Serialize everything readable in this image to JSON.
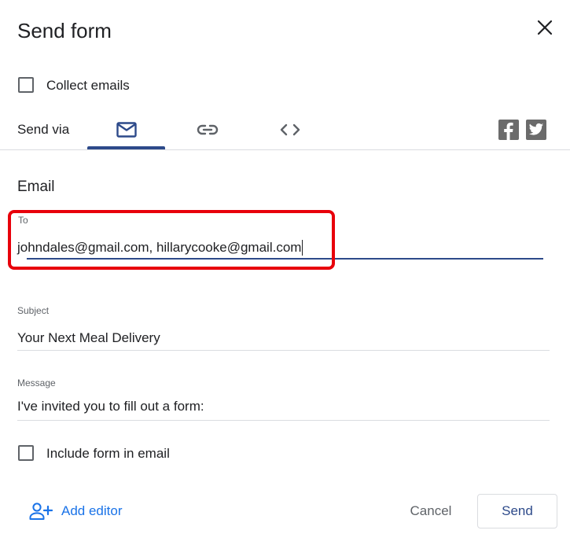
{
  "dialog": {
    "title": "Send form",
    "close_icon": "close-icon"
  },
  "collect_emails": {
    "label": "Collect emails",
    "checked": false
  },
  "send_via": {
    "label": "Send via",
    "tabs": [
      {
        "icon": "mail-icon",
        "active": true
      },
      {
        "icon": "link-icon",
        "active": false
      },
      {
        "icon": "code-embed-icon",
        "active": false
      }
    ],
    "social": [
      {
        "icon": "facebook-icon"
      },
      {
        "icon": "twitter-icon"
      }
    ],
    "accent_color": "#2d4a8a"
  },
  "email": {
    "section_title": "Email",
    "to": {
      "label": "To",
      "value": "johndales@gmail.com, hillarycooke@gmail.com"
    },
    "subject": {
      "label": "Subject",
      "value": "Your Next Meal Delivery"
    },
    "message": {
      "label": "Message",
      "value": "I've invited you to fill out a form:"
    }
  },
  "include_form": {
    "label": "Include form in email",
    "checked": false
  },
  "footer": {
    "add_editor_label": "Add editor",
    "add_editor_icon": "person-add-icon",
    "cancel_label": "Cancel",
    "send_label": "Send"
  },
  "highlight_color": "#e8000b"
}
